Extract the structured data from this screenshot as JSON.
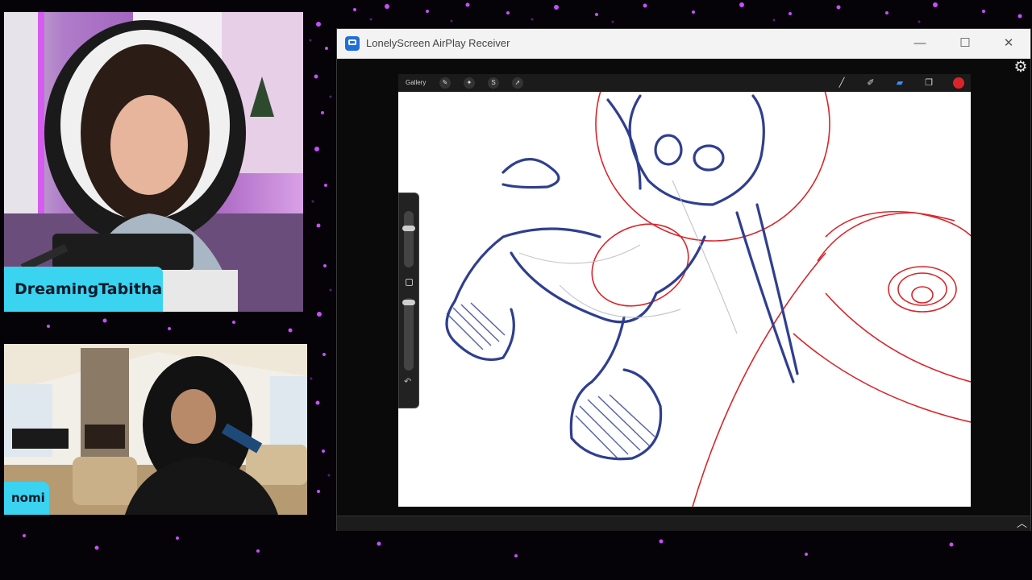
{
  "participants": [
    {
      "name": "DreamingTabitha"
    },
    {
      "name": "nomi"
    }
  ],
  "window": {
    "title": "LonelyScreen AirPlay Receiver",
    "controls": {
      "minimize": "—",
      "maximize": "☐",
      "close": "✕"
    }
  },
  "procreate": {
    "gallery_label": "Gallery"
  },
  "colors": {
    "name_tag": "#3ad3f0",
    "background_sparkle": "#c94dff",
    "brush_red": "#d9252a",
    "sketch_blue": "#2f3f8f"
  }
}
